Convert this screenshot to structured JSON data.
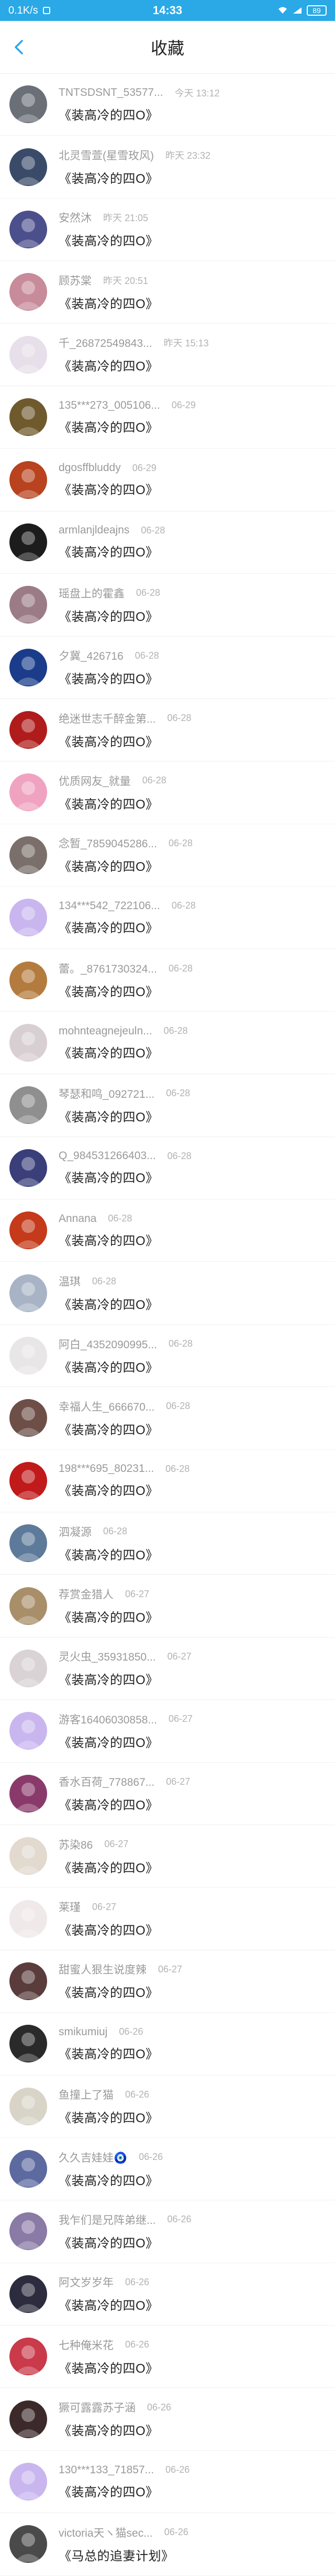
{
  "status": {
    "speed": "0.1K/s",
    "time": "14:33",
    "battery": "89"
  },
  "header": {
    "title": "收藏"
  },
  "items": [
    {
      "user": "TNTSDSNT_53577...",
      "time": "今天 13:12",
      "book": "《装高冷的四O》",
      "color": "#6a6f78"
    },
    {
      "user": "北灵雪萱(星雪玫风)",
      "time": "昨天 23:32",
      "book": "《装高冷的四O》",
      "color": "#3a4b6a"
    },
    {
      "user": "安然沐",
      "time": "昨天 21:05",
      "book": "《装高冷的四O》",
      "color": "#4b4f8c"
    },
    {
      "user": "顾苏棠",
      "time": "昨天 20:51",
      "book": "《装高冷的四O》",
      "color": "#c78b9a"
    },
    {
      "user": "千_26872549843...",
      "time": "昨天 15:13",
      "book": "《装高冷的四O》",
      "color": "#e7dfe9"
    },
    {
      "user": "135***273_005106...",
      "time": "06-29",
      "book": "《装高冷的四O》",
      "color": "#6f5a2e"
    },
    {
      "user": "dgosffbluddy",
      "time": "06-29",
      "book": "《装高冷的四O》",
      "color": "#b8431e"
    },
    {
      "user": "armlanjldeajns",
      "time": "06-28",
      "book": "《装高冷的四O》",
      "color": "#1c1c1c"
    },
    {
      "user": "瑶盘上的霍鑫",
      "time": "06-28",
      "book": "《装高冷的四O》",
      "color": "#9a7b86"
    },
    {
      "user": "夕冀_426716",
      "time": "06-28",
      "book": "《装高冷的四O》",
      "color": "#1a3c8a"
    },
    {
      "user": "绝迷世志千醉金第...",
      "time": "06-28",
      "book": "《装高冷的四O》",
      "color": "#b01c1c"
    },
    {
      "user": "优质网友_就量",
      "time": "06-28",
      "book": "《装高冷的四O》",
      "color": "#f0a3c0"
    },
    {
      "user": "念暂_7859045286...",
      "time": "06-28",
      "book": "《装高冷的四O》",
      "color": "#7a6f6a"
    },
    {
      "user": "134***542_722106...",
      "time": "06-28",
      "book": "《装高冷的四O》",
      "color": "#c9b6ef"
    },
    {
      "user": "蕾。_8761730324...",
      "time": "06-28",
      "book": "《装高冷的四O》",
      "color": "#b47b3e"
    },
    {
      "user": "mohnteagnejeuln...",
      "time": "06-28",
      "book": "《装高冷的四O》",
      "color": "#d8cfd2"
    },
    {
      "user": "琴瑟和鸣_092721...",
      "time": "06-28",
      "book": "《装高冷的四O》",
      "color": "#8f8f8f"
    },
    {
      "user": "Q_984531266403...",
      "time": "06-28",
      "book": "《装高冷的四O》",
      "color": "#3a3f7a"
    },
    {
      "user": "Annana",
      "time": "06-28",
      "book": "《装高冷的四O》",
      "color": "#c43a1a"
    },
    {
      "user": "温琪",
      "time": "06-28",
      "book": "《装高冷的四O》",
      "color": "#a8b4c6"
    },
    {
      "user": "阿白_4352090995...",
      "time": "06-28",
      "book": "《装高冷的四O》",
      "color": "#e8e6e6"
    },
    {
      "user": "幸福人生_666670...",
      "time": "06-28",
      "book": "《装高冷的四O》",
      "color": "#6d4f48"
    },
    {
      "user": "198***695_80231...",
      "time": "06-28",
      "book": "《装高冷的四O》",
      "color": "#c01a1a"
    },
    {
      "user": "泗凝源",
      "time": "06-28",
      "book": "《装高冷的四O》",
      "color": "#5e7a9a"
    },
    {
      "user": "荐赏金猎人",
      "time": "06-27",
      "book": "《装高冷的四O》",
      "color": "#a88f6a"
    },
    {
      "user": "灵火虫_35931850...",
      "time": "06-27",
      "book": "《装高冷的四O》",
      "color": "#d9d3d6"
    },
    {
      "user": "游客16406030858...",
      "time": "06-27",
      "book": "《装高冷的四O》",
      "color": "#c9b6ef"
    },
    {
      "user": "香水百荷_778867...",
      "time": "06-27",
      "book": "《装高冷的四O》",
      "color": "#8a3a6a"
    },
    {
      "user": "苏染86",
      "time": "06-27",
      "book": "《装高冷的四O》",
      "color": "#e2d9cf"
    },
    {
      "user": "莱瑾",
      "time": "06-27",
      "book": "《装高冷的四O》",
      "color": "#efe9ea"
    },
    {
      "user": "甜蜜人狠生说度辣",
      "time": "06-27",
      "book": "《装高冷的四O》",
      "color": "#5a3c3c"
    },
    {
      "user": "smikumiuj",
      "time": "06-26",
      "book": "《装高冷的四O》",
      "color": "#2a2a2a"
    },
    {
      "user": "鱼撞上了猫",
      "time": "06-26",
      "book": "《装高冷的四O》",
      "color": "#d8d4c7"
    },
    {
      "user": "久久吉娃娃🧿",
      "time": "06-26",
      "book": "《装高冷的四O》",
      "color": "#5d6aa0"
    },
    {
      "user": "我乍们是兄阵弟继...",
      "time": "06-26",
      "book": "《装高冷的四O》",
      "color": "#8a7aa6"
    },
    {
      "user": "阿文岁岁年",
      "time": "06-26",
      "book": "《装高冷的四O》",
      "color": "#2c2c3e"
    },
    {
      "user": "七种俺米花",
      "time": "06-26",
      "book": "《装高冷的四O》",
      "color": "#c93a4a"
    },
    {
      "user": "獗可露露苏子涵",
      "time": "06-26",
      "book": "《装高冷的四O》",
      "color": "#3c2a2a"
    },
    {
      "user": "130***133_71857...",
      "time": "06-26",
      "book": "《装高冷的四O》",
      "color": "#c9b6ef"
    },
    {
      "user": "victoria天ヽ猫sec...",
      "time": "06-26",
      "book": "《马总的追妻计划》",
      "color": "#4a4a4a"
    }
  ]
}
